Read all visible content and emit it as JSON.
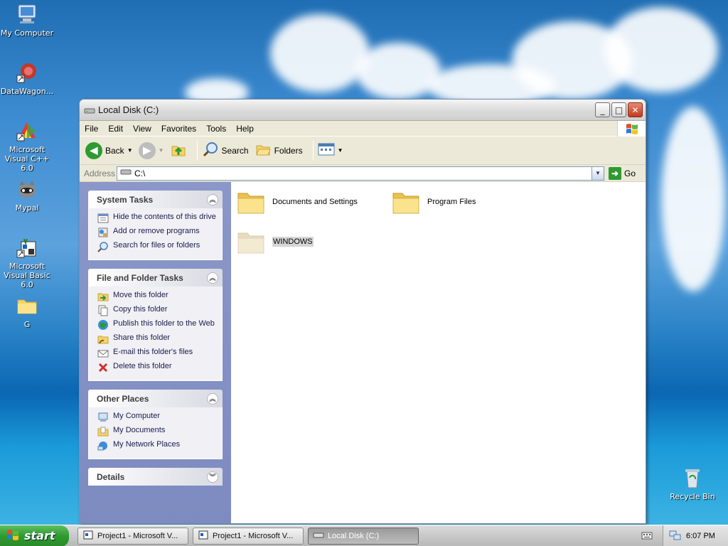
{
  "desktop": {
    "icons": [
      {
        "label": "My Computer",
        "icon": "my-computer-icon"
      },
      {
        "label": "DataWagon...",
        "icon": "datawagon-icon"
      },
      {
        "label": "Microsoft Visual C++ 6.0",
        "icon": "visual-cpp-icon"
      },
      {
        "label": "Mypal",
        "icon": "mypal-icon"
      },
      {
        "label": "Microsoft Visual Basic 6.0",
        "icon": "visual-basic-icon"
      },
      {
        "label": "G",
        "icon": "folder-icon"
      },
      {
        "label": "Recycle Bin",
        "icon": "recycle-bin-icon"
      }
    ]
  },
  "window": {
    "title": "Local Disk (C:)",
    "menu": [
      "File",
      "Edit",
      "View",
      "Favorites",
      "Tools",
      "Help"
    ],
    "toolbar": {
      "back_label": "Back",
      "search_label": "Search",
      "folders_label": "Folders"
    },
    "address": {
      "label": "Address",
      "value": "C:\\",
      "go_label": "Go"
    },
    "taskpane": {
      "system_tasks": {
        "title": "System Tasks",
        "items": [
          "Hide the contents of this drive",
          "Add or remove programs",
          "Search for files or folders"
        ]
      },
      "file_folder_tasks": {
        "title": "File and Folder Tasks",
        "items": [
          "Move this folder",
          "Copy this folder",
          "Publish this folder to the Web",
          "Share this folder",
          "E-mail this folder's files",
          "Delete this folder"
        ]
      },
      "other_places": {
        "title": "Other Places",
        "items": [
          "My Computer",
          "My Documents",
          "My Network Places"
        ]
      },
      "details": {
        "title": "Details"
      }
    },
    "files": [
      {
        "name": "Documents and Settings"
      },
      {
        "name": "Program Files"
      },
      {
        "name": "WINDOWS",
        "selected": true
      }
    ]
  },
  "taskbar": {
    "start_label": "start",
    "tasks": [
      {
        "label": "Project1 - Microsoft V..."
      },
      {
        "label": "Project1 - Microsoft V..."
      },
      {
        "label": "Local Disk (C:)",
        "active": true
      }
    ],
    "clock": "6:07 PM"
  }
}
